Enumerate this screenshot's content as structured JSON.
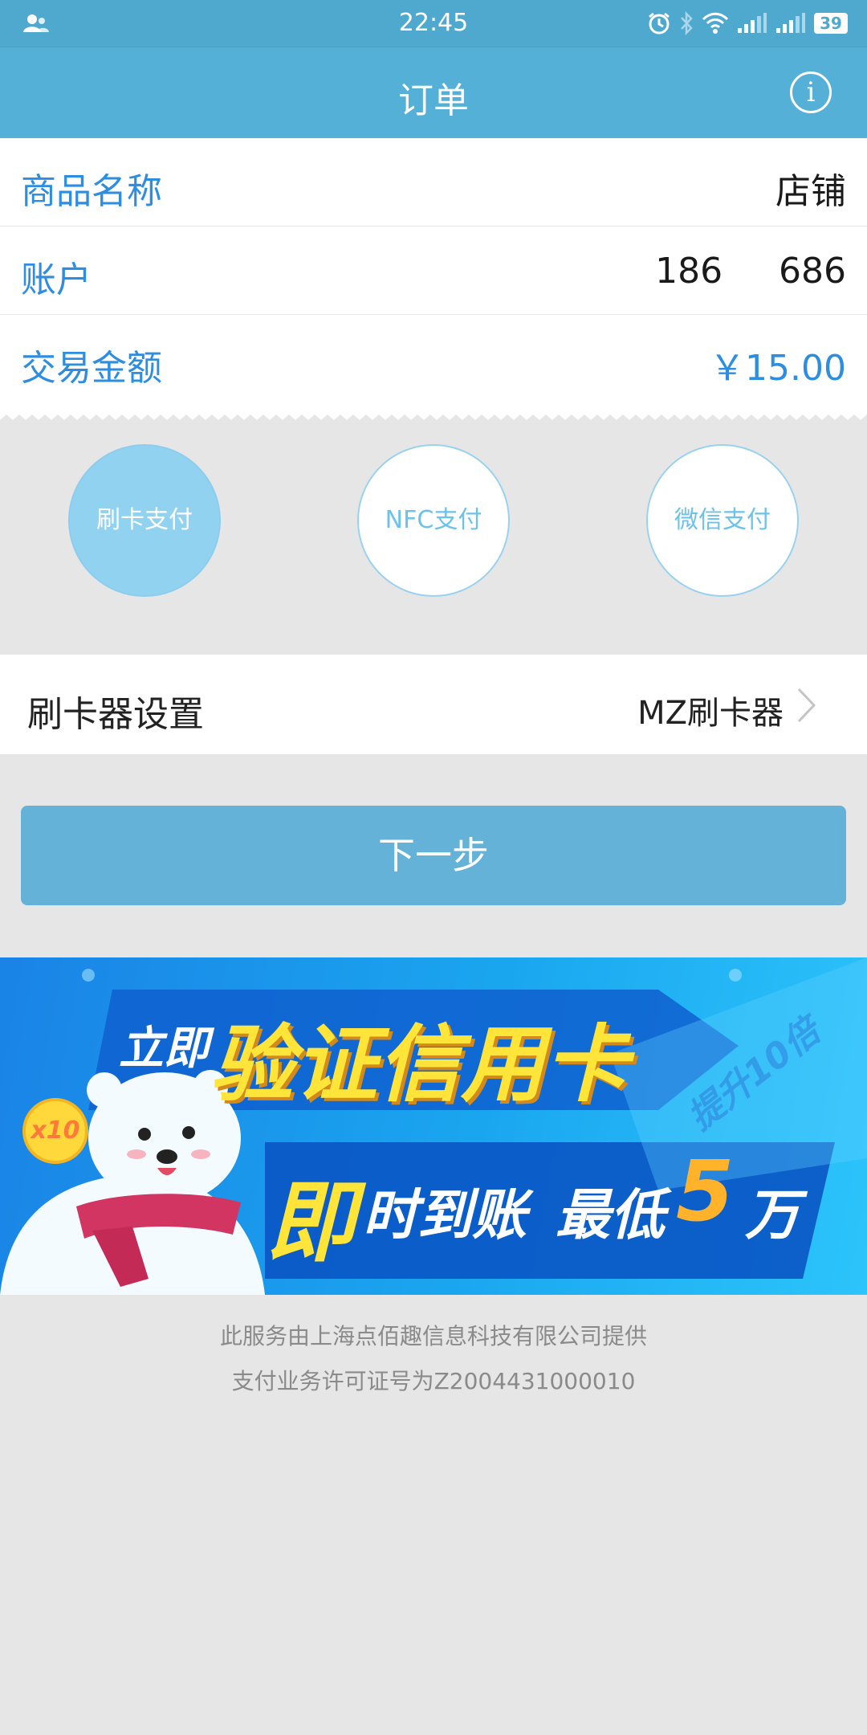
{
  "status_bar": {
    "time": "22:45",
    "battery": "39",
    "icons": [
      "user-icon",
      "alarm-icon",
      "bluetooth-icon",
      "wifi-icon",
      "signal-icon",
      "signal-icon",
      "battery-icon"
    ]
  },
  "header": {
    "title": "订单",
    "info_icon": "i"
  },
  "order": {
    "rows": [
      {
        "label": "商品名称",
        "value": "店铺"
      },
      {
        "label": "账户",
        "value": "186     686"
      },
      {
        "label": "交易金额",
        "value": "￥15.00"
      }
    ]
  },
  "payment_methods": [
    {
      "label": "刷卡支付",
      "selected": true
    },
    {
      "label": "NFC支付",
      "selected": false
    },
    {
      "label": "微信支付",
      "selected": false
    }
  ],
  "reader": {
    "label": "刷卡器设置",
    "value": "MZ刷卡器"
  },
  "next_button": "下一步",
  "banner": {
    "line1_prefix": "立即",
    "line1_main": "验证信用卡",
    "line2_a": "即",
    "line2_b": "时到账",
    "line2_c": "最低",
    "line2_num": "5",
    "line2_unit": "万",
    "coin": "x10",
    "side": "提升10倍"
  },
  "footer": {
    "line1": "此服务由上海点佰趣信息科技有限公司提供",
    "line2": "支付业务许可证号为Z2004431000010"
  },
  "colors": {
    "header": "#54b0d6",
    "accent": "#2d8de0",
    "selected_circle": "#92d2f1",
    "button": "#64b2d8",
    "background": "#e6e6e6"
  }
}
